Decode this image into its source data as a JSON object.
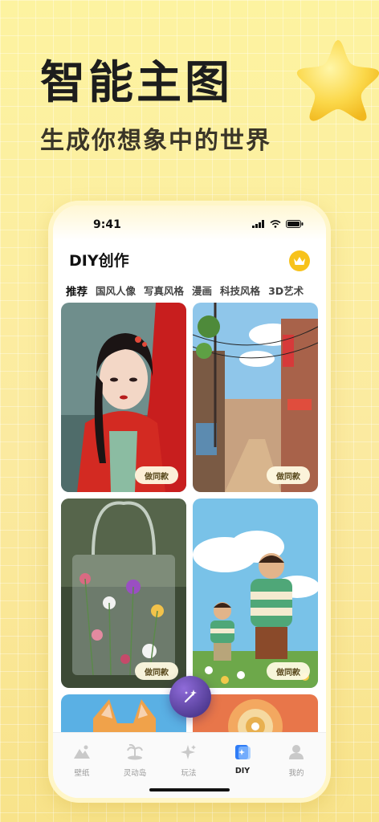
{
  "promo": {
    "headline": "智能主图",
    "subline": "生成你想象中的世界"
  },
  "status_bar": {
    "time": "9:41"
  },
  "header": {
    "title": "DIY创作"
  },
  "tabs": [
    "推荐",
    "国风人像",
    "写真风格",
    "漫画",
    "科技风格",
    "3D艺术"
  ],
  "cards": [
    {
      "image": "红衣古风女子",
      "button": "做同款"
    },
    {
      "image": "动漫街景",
      "button": "做同款"
    },
    {
      "image": "透明包里的花束",
      "button": "做同款"
    },
    {
      "image": "3D卡通父子",
      "button": "做同款"
    },
    {
      "image": "橘猫",
      "button": ""
    },
    {
      "image": "太阳图腾",
      "button": ""
    }
  ],
  "tabbar": [
    {
      "label": "壁纸",
      "icon": "mountain-icon"
    },
    {
      "label": "灵动岛",
      "icon": "island-icon"
    },
    {
      "label": "玩法",
      "icon": "sparkle-icon"
    },
    {
      "label": "DIY",
      "icon": "diy-icon",
      "active": true
    },
    {
      "label": "我的",
      "icon": "person-icon"
    }
  ],
  "colors": {
    "accent": "#f6cf3a",
    "fab": "#5a3fa8",
    "background": "#fbeaa0"
  }
}
